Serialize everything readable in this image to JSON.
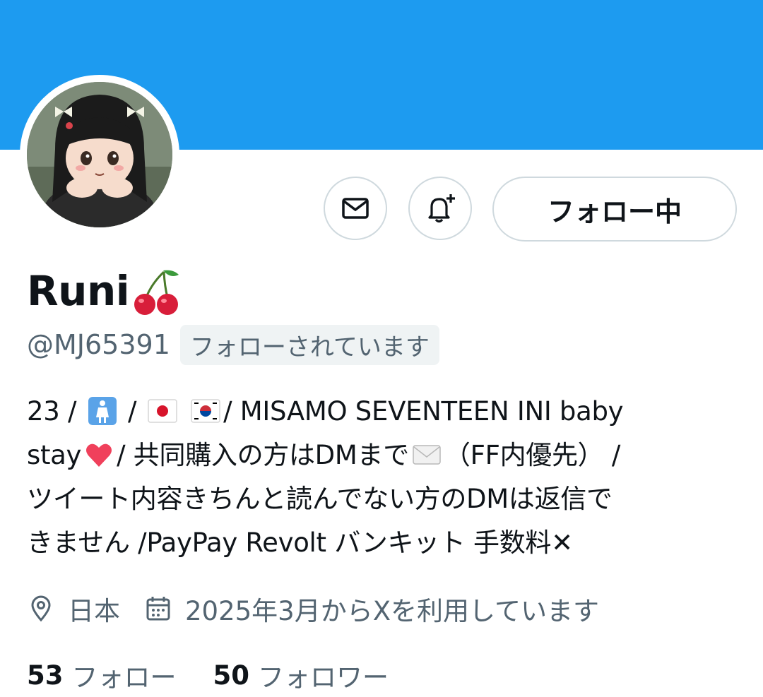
{
  "profile": {
    "name": "Runi",
    "name_emoji": "cherry-icon",
    "handle": "@MJ65391",
    "follows_you_badge": "フォローされています"
  },
  "actions": {
    "message_icon": "mail-icon",
    "notify_icon": "bell-plus-icon",
    "follow_label": "フォロー中"
  },
  "bio": {
    "line1_a": "23 /",
    "line1_b": "/",
    "line1_c": "/ MISAMO SEVENTEEN INI baby",
    "line2_a": "stay",
    "line2_b": "/ 共同購入の方はDMまで",
    "line2_c": "（FF内優先）  /",
    "line3": "ツイート内容きちんと読んでない方のDMは返信で",
    "line4": "きません /PayPay Revolt バンキット 手数料✕"
  },
  "meta": {
    "location_icon": "location-pin-icon",
    "location": "日本",
    "calendar_icon": "calendar-icon",
    "joined": "2025年3月からXを利用しています"
  },
  "stats": {
    "following_count": "53",
    "following_label": "フォロー",
    "followers_count": "50",
    "followers_label": "フォロワー"
  },
  "colors": {
    "banner": "#1d9bf0",
    "secondary_text": "#536471",
    "border": "#cfd9de"
  }
}
